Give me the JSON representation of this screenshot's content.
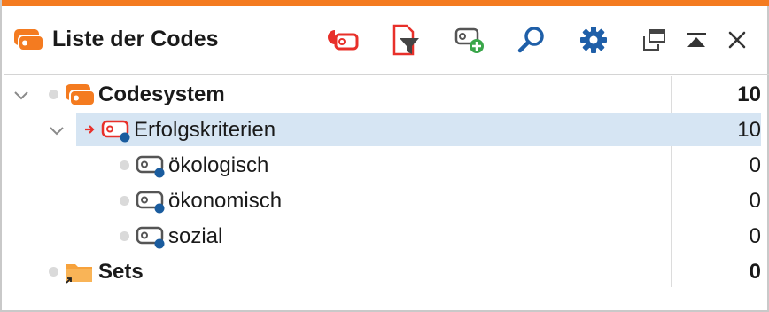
{
  "colors": {
    "accent": "#f47b20",
    "selection": "#d6e5f3",
    "code_red": "#e8302a",
    "code_blue": "#1a5c9e",
    "toolbar_blue": "#1f5fa8"
  },
  "header": {
    "title": "Liste der Codes",
    "title_icon": "code-tag-orange-icon",
    "toolbar": [
      {
        "name": "undo-code-icon"
      },
      {
        "name": "filter-document-icon"
      },
      {
        "name": "new-code-icon"
      },
      {
        "name": "search-icon"
      },
      {
        "name": "settings-gear-icon"
      },
      {
        "name": "undock-window-icon"
      },
      {
        "name": "collapse-up-icon"
      },
      {
        "name": "close-icon"
      }
    ]
  },
  "tree": {
    "rows": [
      {
        "label": "Codesystem",
        "count": "10",
        "bold": true,
        "icon": "codesystem-icon",
        "expanded": true
      },
      {
        "label": "Erfolgskriterien",
        "count": "10",
        "bold": false,
        "icon": "code-red-icon",
        "expanded": true,
        "selected": true
      },
      {
        "label": "ökologisch",
        "count": "0",
        "bold": false,
        "icon": "code-gray-icon"
      },
      {
        "label": "ökonomisch",
        "count": "0",
        "bold": false,
        "icon": "code-gray-icon"
      },
      {
        "label": "sozial",
        "count": "0",
        "bold": false,
        "icon": "code-gray-icon"
      },
      {
        "label": "Sets",
        "count": "0",
        "bold": true,
        "icon": "sets-folder-icon"
      }
    ]
  }
}
